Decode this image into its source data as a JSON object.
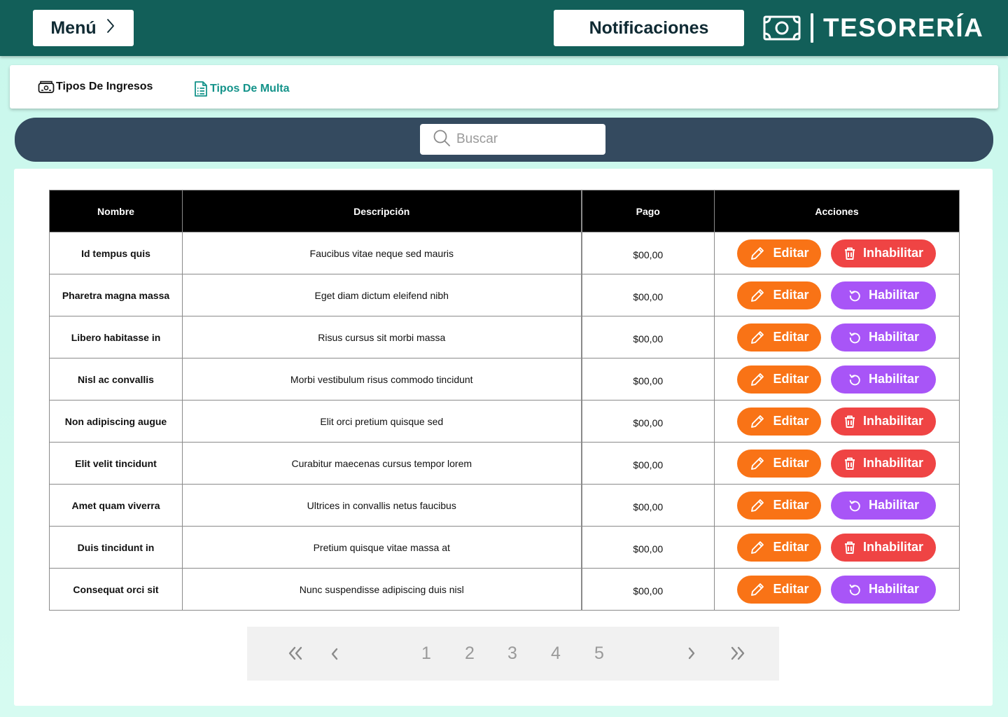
{
  "header": {
    "menu_label": "Menú",
    "notifications_label": "Notificaciones",
    "brand_title": "TESORERÍA"
  },
  "tabs": [
    {
      "label": "Tipos De Ingresos",
      "active": false
    },
    {
      "label": "Tipos De Multa",
      "active": true
    }
  ],
  "search": {
    "placeholder": "Buscar",
    "value": ""
  },
  "table": {
    "columns": [
      "Nombre",
      "Descripción",
      "Pago",
      "Acciones"
    ],
    "rows": [
      {
        "nombre": "Id tempus quis",
        "descripcion": "Faucibus vitae neque sed mauris",
        "pago": "$00,00",
        "toggle": "Inhabilitar"
      },
      {
        "nombre": "Pharetra magna massa",
        "descripcion": "Eget diam dictum eleifend nibh",
        "pago": "$00,00",
        "toggle": "Habilitar"
      },
      {
        "nombre": "Libero habitasse in",
        "descripcion": "Risus cursus sit morbi massa",
        "pago": "$00,00",
        "toggle": "Habilitar"
      },
      {
        "nombre": "Nisl ac convallis",
        "descripcion": "Morbi vestibulum risus commodo tincidunt",
        "pago": "$00,00",
        "toggle": "Habilitar"
      },
      {
        "nombre": "Non adipiscing augue",
        "descripcion": "Elit orci pretium quisque sed",
        "pago": "$00,00",
        "toggle": "Inhabilitar"
      },
      {
        "nombre": "Elit velit tincidunt",
        "descripcion": "Curabitur maecenas cursus tempor lorem",
        "pago": "$00,00",
        "toggle": "Inhabilitar"
      },
      {
        "nombre": "Amet quam viverra",
        "descripcion": "Ultrices in convallis netus faucibus",
        "pago": "$00,00",
        "toggle": "Habilitar"
      },
      {
        "nombre": "Duis tincidunt in",
        "descripcion": "Pretium quisque vitae massa at",
        "pago": "$00,00",
        "toggle": "Inhabilitar"
      },
      {
        "nombre": "Consequat orci sit",
        "descripcion": "Nunc suspendisse adipiscing duis nisl",
        "pago": "$00,00",
        "toggle": "Habilitar"
      }
    ],
    "edit_label": "Editar"
  },
  "pagination": {
    "pages": [
      "1",
      "2",
      "3",
      "4",
      "5"
    ],
    "icons": [
      "double-chevron-left-icon",
      "chevron-left-icon",
      "chevron-right-icon",
      "double-chevron-right-icon"
    ]
  },
  "colors": {
    "header_bg": "#125f59",
    "search_band": "#344a5f",
    "active_tab": "#14938a",
    "edit": "#f97316",
    "disable": "#ef4444",
    "enable": "#a855f7"
  }
}
